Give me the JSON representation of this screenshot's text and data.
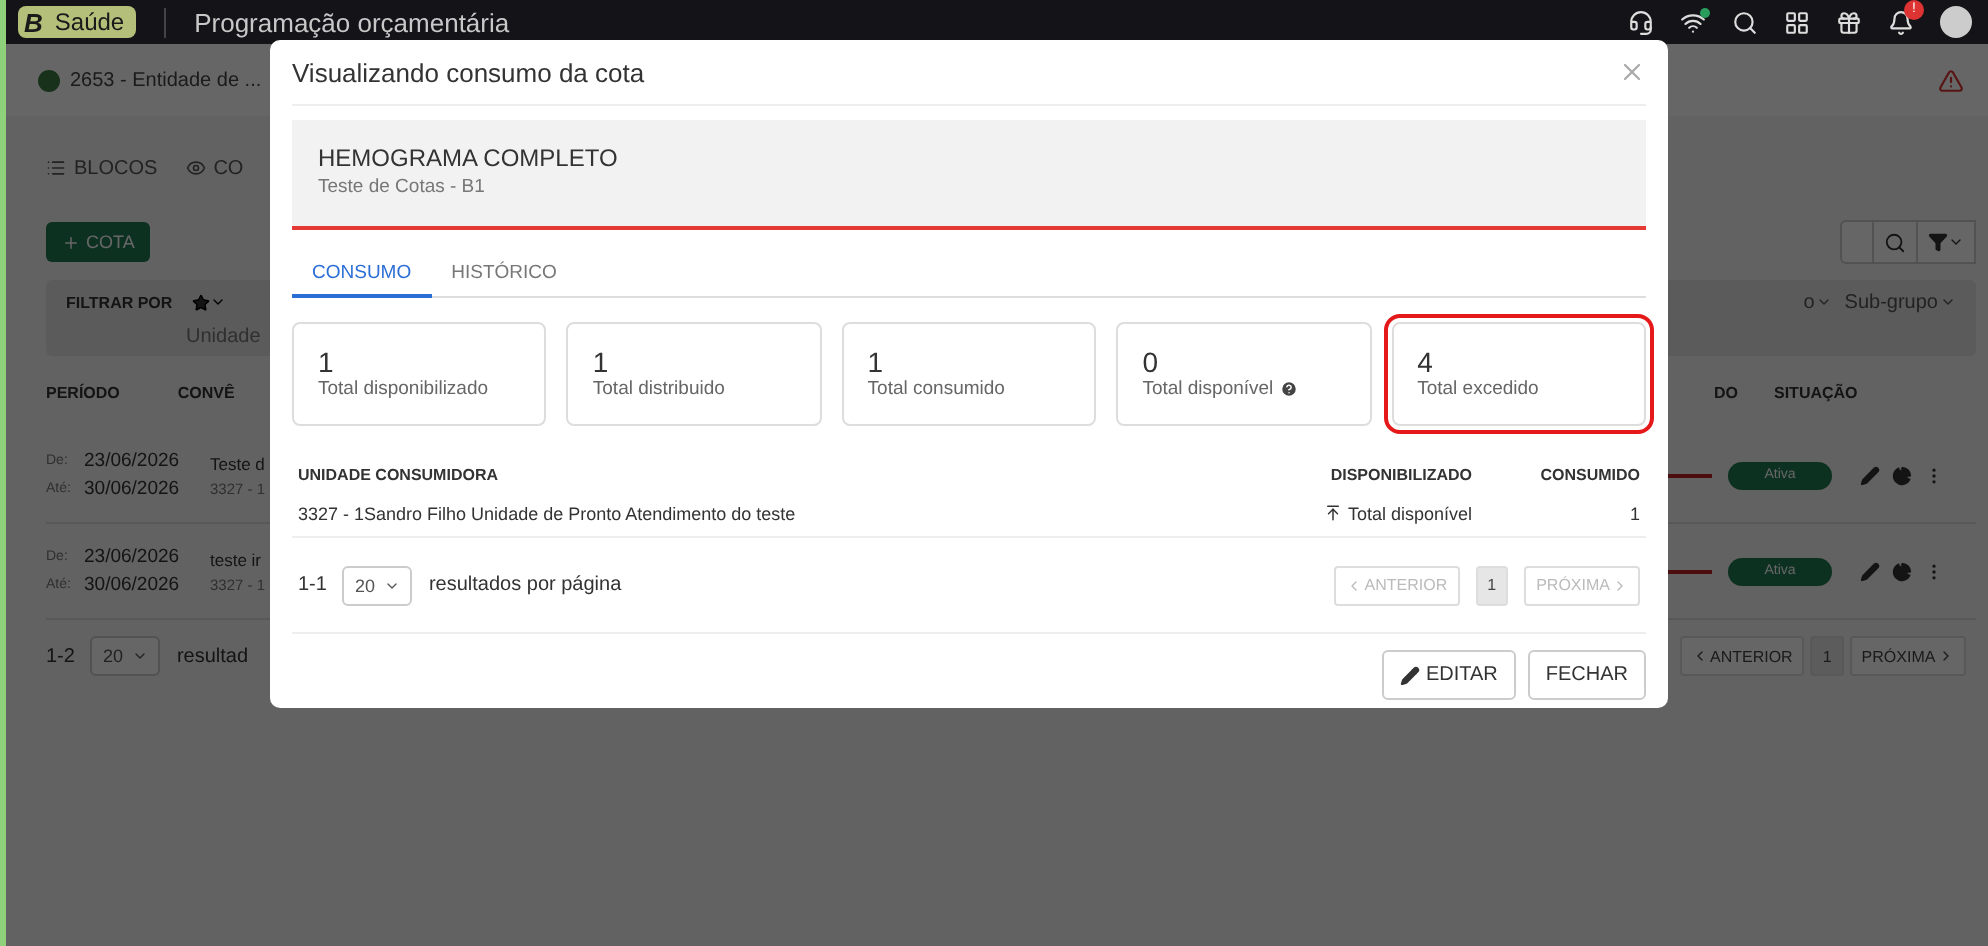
{
  "topbar": {
    "logo": "B",
    "product": "Saúde",
    "module": "Programação orçamentária",
    "notification_badge": "!"
  },
  "entity": {
    "name": "2653 - Entidade de ..."
  },
  "page_tabs": [
    {
      "label": "BLOCOS",
      "selected": false
    },
    {
      "label": "CO",
      "selected": false
    }
  ],
  "add_button": "COTA",
  "filter": {
    "label": "FILTRAR POR",
    "field": "Unidade",
    "right_filters": [
      "o",
      "Sub-grupo"
    ]
  },
  "table": {
    "columns_left": [
      "PERÍODO",
      "CONVÊ"
    ],
    "columns_right": [
      "DO",
      "SITUAÇÃO"
    ],
    "rows": [
      {
        "from_label": "De:",
        "from": "23/06/2026",
        "to_label": "Até:",
        "to": "30/06/2026",
        "name": "Teste d",
        "code": "3327 - 1",
        "status": "Ativa"
      },
      {
        "from_label": "De:",
        "from": "23/06/2026",
        "to_label": "Até:",
        "to": "30/06/2026",
        "name": "teste ir",
        "code": "3327 - 1",
        "status": "Ativa"
      }
    ]
  },
  "pagination": {
    "range": "1-2",
    "per_page": "20",
    "per_page_label": "resultad",
    "previous": "ANTERIOR",
    "page": "1",
    "next": "PRÓXIMA"
  },
  "modal": {
    "title": "Visualizando consumo da cota",
    "item": {
      "name": "HEMOGRAMA COMPLETO",
      "subtitle": "Teste de Cotas - B1"
    },
    "tabs": [
      {
        "label": "CONSUMO",
        "selected": true
      },
      {
        "label": "HISTÓRICO",
        "selected": false
      }
    ],
    "stats": [
      {
        "value": "1",
        "label": "Total disponibilizado",
        "help": false,
        "highlighted": false
      },
      {
        "value": "1",
        "label": "Total distribuido",
        "help": false,
        "highlighted": false
      },
      {
        "value": "1",
        "label": "Total consumido",
        "help": false,
        "highlighted": false
      },
      {
        "value": "0",
        "label": "Total disponível",
        "help": true,
        "highlighted": false
      },
      {
        "value": "4",
        "label": "Total excedido",
        "help": false,
        "highlighted": true
      }
    ],
    "table": {
      "columns": [
        "UNIDADE CONSUMIDORA",
        "DISPONIBILIZADO",
        "CONSUMIDO"
      ],
      "rows": [
        {
          "unit": "3327 - 1Sandro Filho Unidade de Pronto Atendimento do teste",
          "available": "Total disponível",
          "consumed": "1"
        }
      ]
    },
    "pagination": {
      "range": "1-1",
      "per_page": "20",
      "per_page_label": "resultados por página",
      "previous": "ANTERIOR",
      "previous_disabled": true,
      "page": "1",
      "next": "PRÓXIMA",
      "next_disabled": true
    },
    "buttons": [
      {
        "kind": "edit",
        "label": "EDITAR"
      },
      {
        "kind": "close",
        "label": "FECHAR"
      }
    ]
  }
}
